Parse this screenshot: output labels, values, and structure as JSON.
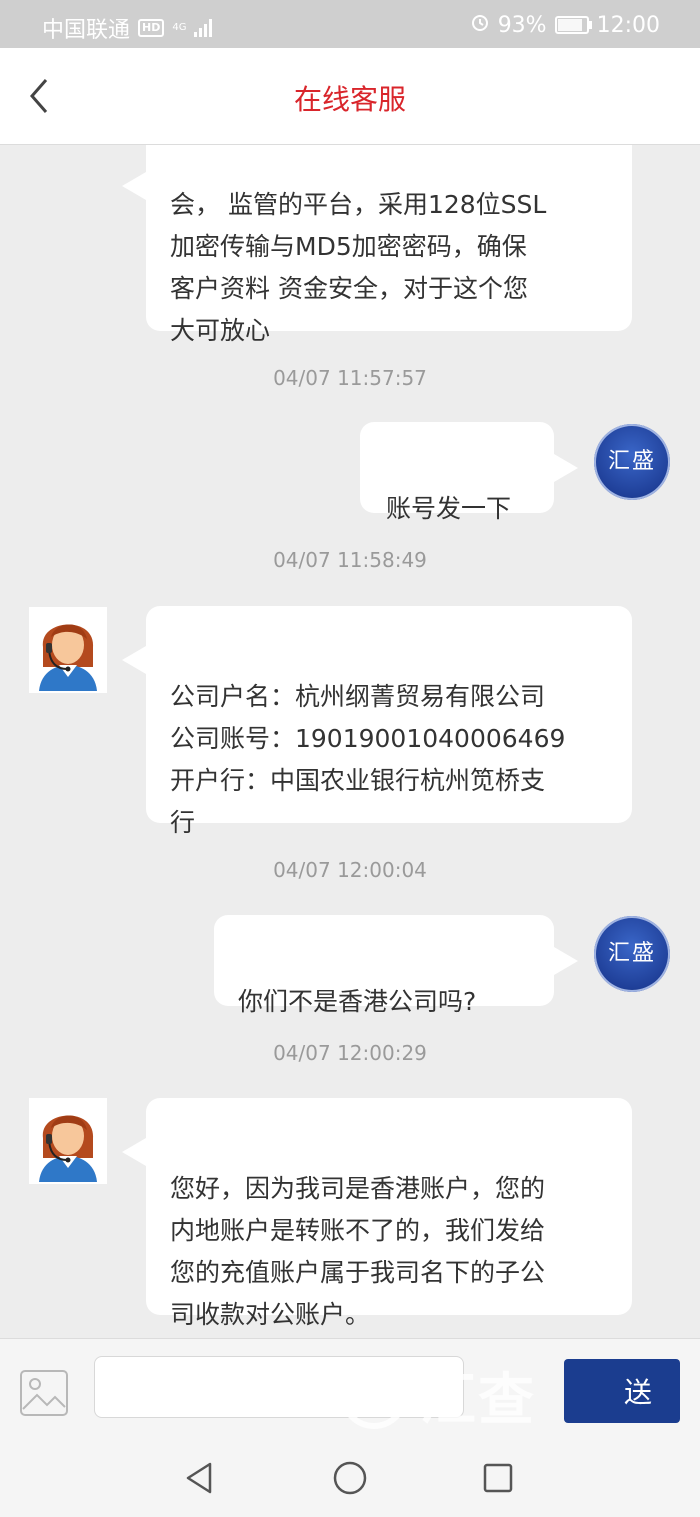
{
  "status_bar": {
    "carrier": "中国联通",
    "hd": "HD",
    "network": "4G",
    "battery": "93%",
    "battery_level": 0.93,
    "time": "12:00"
  },
  "header": {
    "title": "在线客服",
    "title_color": "#d9252b"
  },
  "user_avatar_text": "汇盛",
  "messages": [
    {
      "side": "left",
      "text": "会， 监管的平台，采用128位SSL\n加密传输与MD5加密密码，确保\n客户资料 资金安全，对于这个您\n大可放心"
    },
    {
      "timestamp": "04/07 11:57:57"
    },
    {
      "side": "right",
      "text": "账号发一下"
    },
    {
      "timestamp": "04/07 11:58:49"
    },
    {
      "side": "left",
      "text": "公司户名：杭州纲菁贸易有限公司\n公司账号：19019001040006469\n开户行：中国农业银行杭州笕桥支\n行"
    },
    {
      "timestamp": "04/07 12:00:04"
    },
    {
      "side": "right",
      "text": "你们不是香港公司吗?"
    },
    {
      "timestamp": "04/07 12:00:29"
    },
    {
      "side": "left",
      "text": "您好，因为我司是香港账户，您的\n内地账户是转账不了的，我们发给\n您的充值账户属于我司名下的子公\n司收款对公账户。"
    }
  ],
  "input_bar": {
    "placeholder": "",
    "send_label": "送",
    "send_color": "#1b3d8f"
  },
  "watermark": {
    "text": "汇查"
  }
}
